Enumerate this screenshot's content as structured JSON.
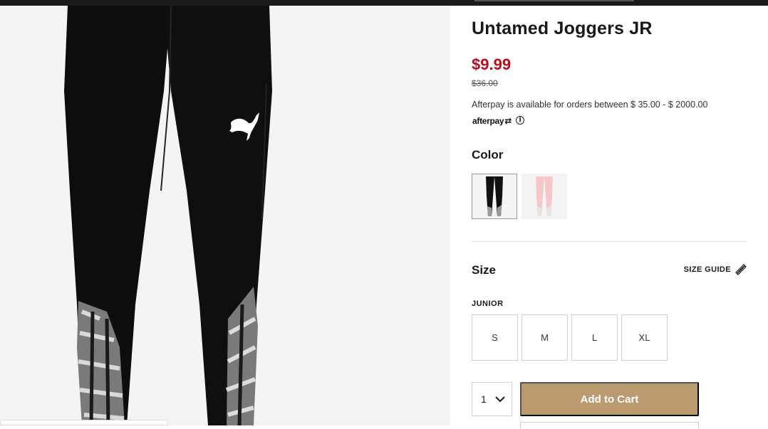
{
  "product": {
    "title": "Untamed Joggers JR",
    "price": "$9.99",
    "original_price": "$36.00",
    "sale_color": "#ba0c1d"
  },
  "afterpay": {
    "text": "Afterpay is available for orders between $ 35.00 - $ 2000.00",
    "logo": "afterpay",
    "logo_mark": "⇄",
    "info_glyph": "i"
  },
  "color": {
    "label": "Color",
    "swatches": [
      {
        "name": "black",
        "color": "#111111",
        "selected": true
      },
      {
        "name": "pink",
        "color": "#f6c7c9",
        "selected": false
      }
    ]
  },
  "size": {
    "label": "Size",
    "guide_label": "SIZE GUIDE",
    "group_label": "JUNIOR",
    "options": [
      "S",
      "M",
      "L",
      "XL"
    ]
  },
  "cart": {
    "quantity": "1",
    "add_label": "Add to Cart",
    "button_color": "#ba9a6e"
  }
}
